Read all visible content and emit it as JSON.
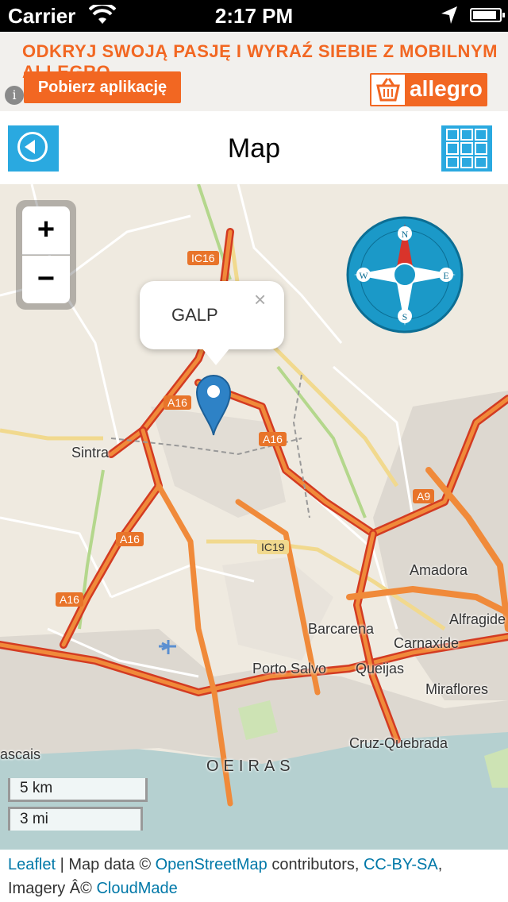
{
  "status_bar": {
    "carrier": "Carrier",
    "time": "2:17 PM",
    "battery_level": 0.9
  },
  "ad": {
    "headline": "ODKRYJ SWOJĄ PASJĘ I WYRAŹ SIEBIE Z MOBILNYM ALLEGRO",
    "cta_label": "Pobierz aplikację",
    "brand": "allegro",
    "info_symbol": "i",
    "accent_color": "#f26722"
  },
  "nav": {
    "title": "Map",
    "back_icon": "back-arrow-icon",
    "menu_icon": "grid-icon",
    "button_color": "#2aa9e0"
  },
  "map": {
    "zoom_in": "+",
    "zoom_out": "−",
    "popup_text": "GALP",
    "popup_close": "×",
    "compass": {
      "n": "N",
      "s": "S",
      "e": "E",
      "w": "W"
    },
    "places": {
      "sintra": "Sintra",
      "amadora": "Amadora",
      "alfragide": "Alfragide",
      "barcarena": "Barcarena",
      "carnaxide": "Carnaxide",
      "porto_salvo": "Porto Salvo",
      "queijas": "Queijas",
      "miraflores": "Miraflores",
      "cruz_quebrada": "Cruz-Quebrada",
      "cascais": "ascais",
      "oeiras": "OEIRAS"
    },
    "roads": {
      "ic16": "IC16",
      "a16_top": "A16",
      "a16_mid": "A16",
      "a16_left": "A16",
      "a16_low": "A16",
      "a9": "A9",
      "ic19": "IC19"
    },
    "scale": {
      "km": "5 km",
      "mi": "3 mi"
    }
  },
  "attribution": {
    "leaflet": "Leaflet",
    "sep1": " | Map data © ",
    "osm": "OpenStreetMap",
    "contributors": " contributors, ",
    "license": "CC-BY-SA",
    "comma": ",",
    "imagery": "Imagery Â© ",
    "cloudmade": "CloudMade"
  }
}
